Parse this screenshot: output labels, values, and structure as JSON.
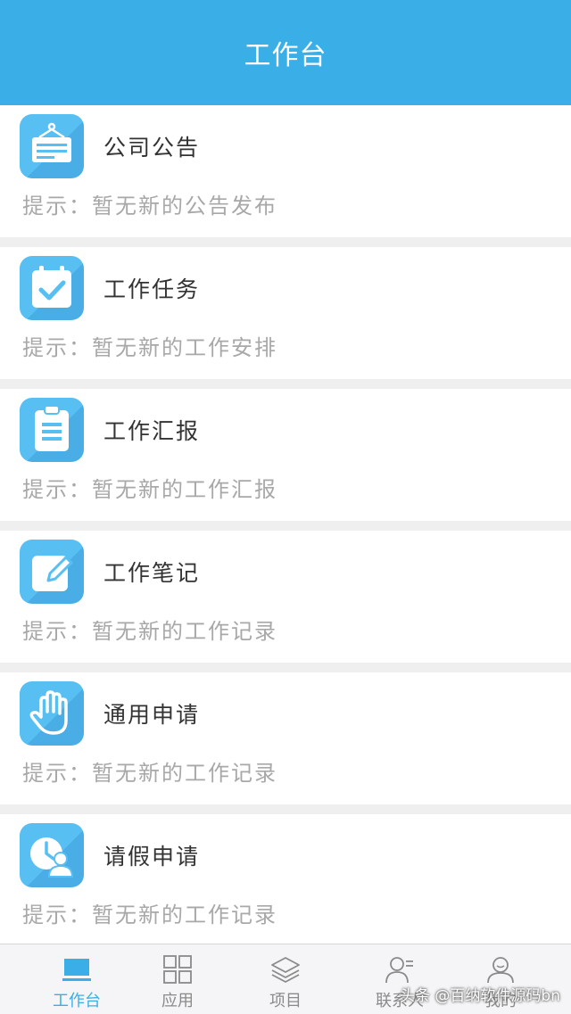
{
  "header": {
    "title": "工作台"
  },
  "cards": [
    {
      "title": "公司公告",
      "hint": "提示：暂无新的公告发布",
      "icon": "announcement-board-icon"
    },
    {
      "title": "工作任务",
      "hint": "提示：暂无新的工作安排",
      "icon": "calendar-check-icon"
    },
    {
      "title": "工作汇报",
      "hint": "提示：暂无新的工作汇报",
      "icon": "clipboard-icon"
    },
    {
      "title": "工作笔记",
      "hint": "提示：暂无新的工作记录",
      "icon": "note-pencil-icon"
    },
    {
      "title": "通用申请",
      "hint": "提示：暂无新的工作记录",
      "icon": "hand-icon"
    },
    {
      "title": "请假申请",
      "hint": "提示：暂无新的工作记录",
      "icon": "clock-person-icon"
    }
  ],
  "tabbar": {
    "tabs": [
      {
        "label": "工作台",
        "icon": "workbench-icon",
        "active": true
      },
      {
        "label": "应用",
        "icon": "apps-grid-icon",
        "active": false
      },
      {
        "label": "项目",
        "icon": "layers-icon",
        "active": false
      },
      {
        "label": "联系人",
        "icon": "contacts-icon",
        "active": false
      },
      {
        "label": "我的",
        "icon": "profile-icon",
        "active": false
      }
    ]
  },
  "watermark": "头条 @百纳软件源码bn",
  "colors": {
    "accent": "#3aaee6",
    "icon_bg": "#58bff2",
    "hint": "#a8a8a8",
    "page_bg": "#efefef"
  }
}
